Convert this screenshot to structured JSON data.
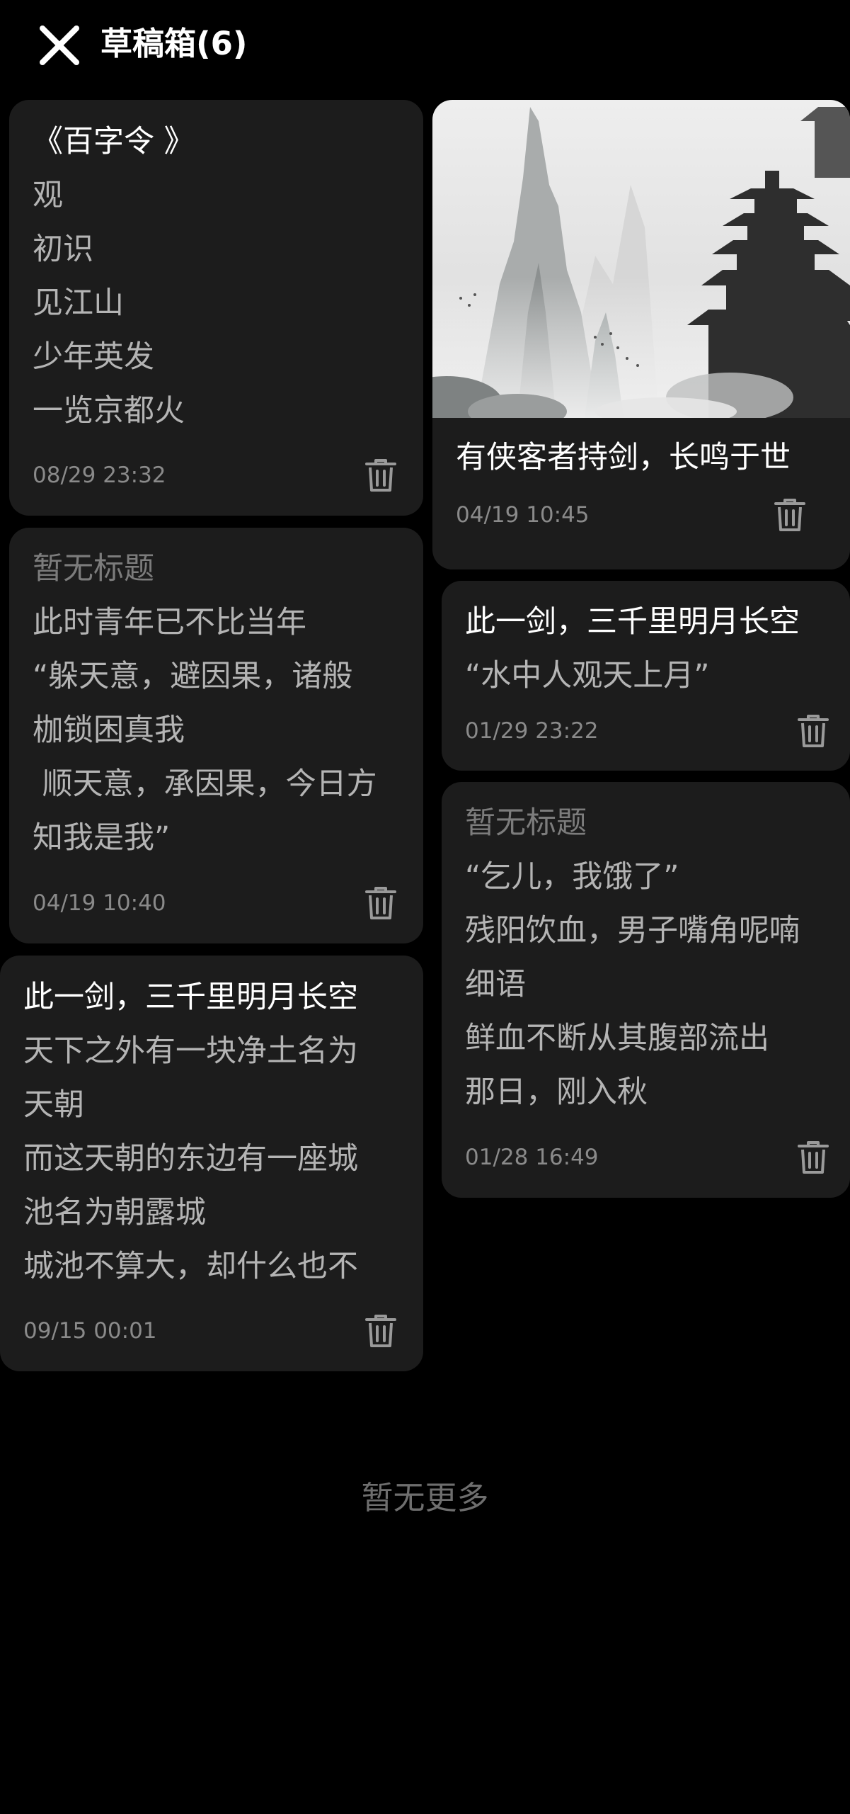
{
  "header": {
    "title": "草稿箱(6)",
    "close_icon": "close-icon"
  },
  "drafts": [
    {
      "title": "《百字令 》",
      "title_is_placeholder": false,
      "lines": [
        "观",
        "初识",
        "见江山",
        "少年英发",
        "一览京都火"
      ],
      "date": "08/29 23:32"
    },
    {
      "title": "暂无标题",
      "title_is_placeholder": true,
      "lines": [
        "此时青年已不比当年",
        "“躲天意，避因果，诸般",
        "枷锁困真我",
        " 顺天意，承因果，今日方",
        "知我是我”"
      ],
      "date": "04/19 10:40"
    },
    {
      "title": "此一剑，三千里明月长空",
      "title_is_placeholder": false,
      "lines": [
        "天下之外有一块净土名为",
        "天朝",
        "而这天朝的东边有一座城",
        "池名为朝露城",
        "城池不算大，却什么也不"
      ],
      "date": "09/15 00:01"
    },
    {
      "title": "有侠客者持剑，长鸣于世",
      "title_is_placeholder": false,
      "has_cover_image": true,
      "lines": [],
      "date": "04/19 10:45"
    },
    {
      "title": "此一剑，三千里明月长空",
      "title_is_placeholder": false,
      "lines": [
        "“水中人观天上月”"
      ],
      "date": "01/29 23:22"
    },
    {
      "title": "暂无标题",
      "title_is_placeholder": true,
      "lines": [
        "“乞儿，我饿了”",
        "残阳饮血，男子嘴角呢喃",
        "细语",
        "鲜血不断从其腹部流出",
        "那日，刚入秋"
      ],
      "date": "01/28 16:49"
    }
  ],
  "footer": {
    "no_more_text": "暂无更多"
  },
  "colors": {
    "background": "#000000",
    "card": "#1c1c1c",
    "title": "#ffffff",
    "placeholder": "#7c7c7c",
    "body": "#b4b4b4",
    "date": "#8a8a8a",
    "icon": "#9a9a9a"
  },
  "icons": {
    "delete": "trash-icon",
    "cover": "ink-painting-mountain-pagoda"
  }
}
